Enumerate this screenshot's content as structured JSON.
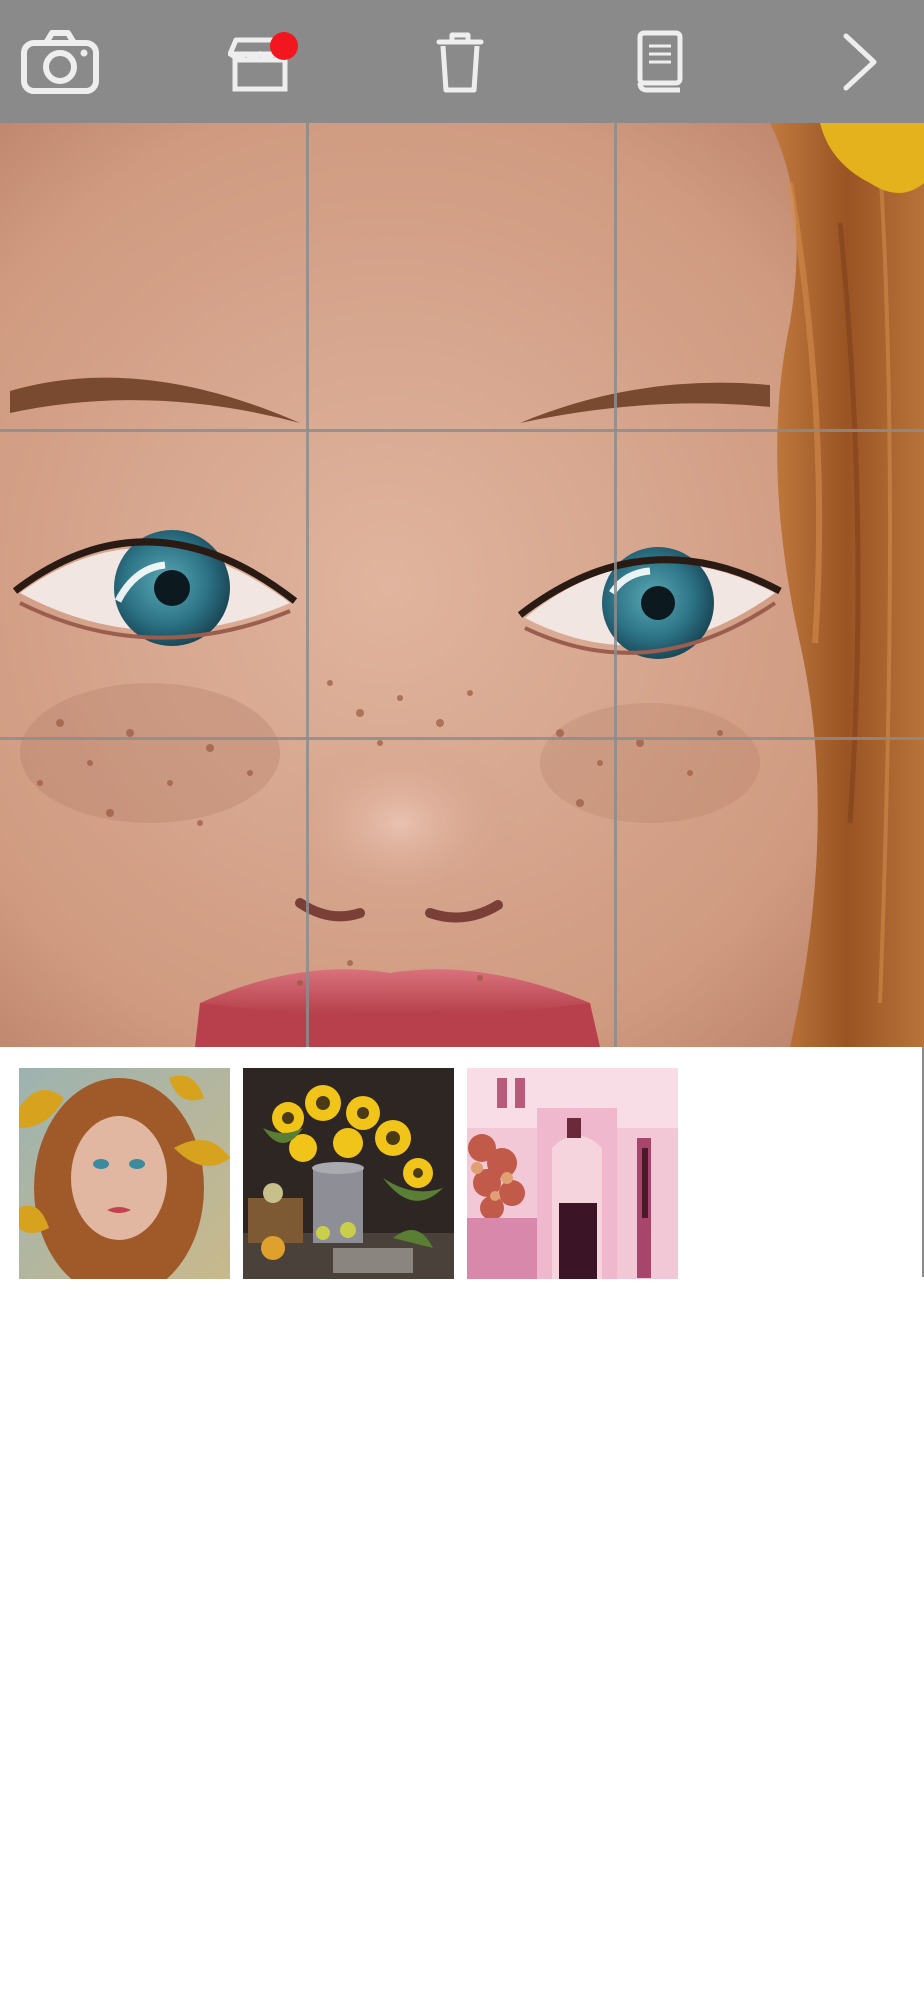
{
  "toolbar": {
    "background": "#8a8a8a",
    "icon_color": "#eeeeee",
    "buttons": [
      {
        "id": "camera",
        "icon": "camera-icon"
      },
      {
        "id": "store",
        "icon": "store-icon",
        "badge": true,
        "badge_color": "#f2161e"
      },
      {
        "id": "delete",
        "icon": "trash-icon"
      },
      {
        "id": "guide",
        "icon": "book-icon"
      },
      {
        "id": "next",
        "icon": "chevron-right-icon"
      }
    ]
  },
  "editor": {
    "image": "portrait-closeup",
    "grid": "3x3",
    "grid_color": "#8c8c8c"
  },
  "thumbnails": [
    {
      "image": "portrait-freckles-sunflower-petals"
    },
    {
      "image": "sunflowers-still-life"
    },
    {
      "image": "pink-alley-doorway"
    }
  ],
  "colors": {
    "skin": "#d8a48c",
    "hair": "#a8602c",
    "iris": "#2f7f95",
    "lips": "#c74a55",
    "accent_yellow": "#e3b21c"
  }
}
